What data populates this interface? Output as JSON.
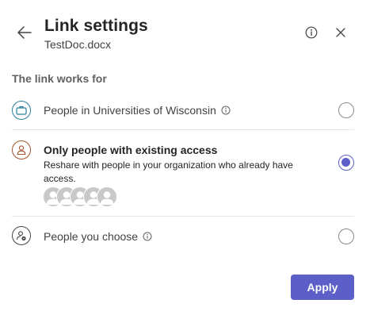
{
  "header": {
    "title": "Link settings",
    "subtitle": "TestDoc.docx"
  },
  "section_label": "The link works for",
  "options": [
    {
      "label": "People in Universities of Wisconsin",
      "icon": "briefcase-icon",
      "selected": false
    },
    {
      "label": "Only people with existing access",
      "description": "Reshare with people in your organization who already have access.",
      "icon": "person-icon",
      "selected": true
    },
    {
      "label": "People you choose",
      "icon": "person-settings-icon",
      "selected": false
    }
  ],
  "apply_label": "Apply",
  "colors": {
    "accent": "#5b5fc7",
    "org_icon": "#2a7d9c",
    "existing_icon": "#a0522d"
  }
}
